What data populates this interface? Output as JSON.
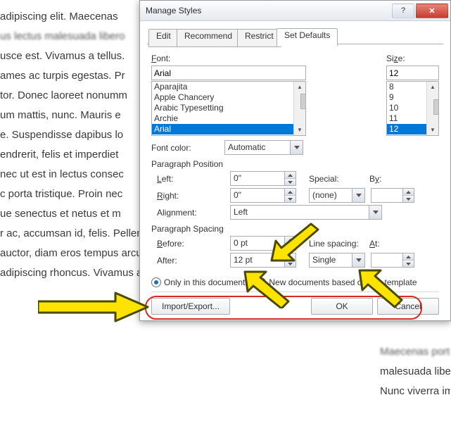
{
  "bg_lines": [
    "adipiscing elit. Maecenas",
    "us lectus malesuada libero",
    "usce est. Vivamus a tellus.",
    "ames ac turpis egestas. Pr",
    "tor. Donec laoreet nonumm",
    "um mattis, nunc. Mauris e",
    "",
    "e. Suspendisse dapibus lo",
    "endrerit, felis et imperdiet",
    "nec ut est in lectus consec",
    "c porta tristique. Proin nec",
    "ue senectus et netus et m",
    "",
    "r ac, accumsan id, felis. Pellentesque cursus sagittis felis.",
    "auctor, diam eros tempus arcu, nec vulputate augue",
    "adipiscing rhoncus. Vivamus a mi. Morbi neque. Aliquam"
  ],
  "right_col_lines": [
    "",
    "",
    "",
    "",
    "",
    "",
    "",
    "",
    "",
    "",
    "",
    "",
    "",
    "Maecenas port",
    "malesuada libe",
    "Nunc viverra im"
  ],
  "dialog": {
    "title": "Manage Styles",
    "tabs": {
      "edit": "Edit",
      "recommend": "Recommend",
      "restrict": "Restrict",
      "set_defaults": "Set Defaults"
    },
    "font_label": "Font:",
    "font_value": "Arial",
    "font_list": [
      "Aparajita",
      "Apple Chancery",
      "Arabic Typesetting",
      "Archie",
      "Arial"
    ],
    "size_label": "Size:",
    "size_value": "12",
    "size_list": [
      "8",
      "9",
      "10",
      "11",
      "12"
    ],
    "font_color_label": "Font color:",
    "font_color_value": "Automatic",
    "paragraph_position_label": "Paragraph Position",
    "left_label": "Left:",
    "left_value": "0\"",
    "right_label": "Right:",
    "right_value": "0\"",
    "special_label": "Special:",
    "special_value": "(none)",
    "by_label": "By:",
    "by_value": "",
    "alignment_label": "Alignment:",
    "alignment_value": "Left",
    "paragraph_spacing_label": "Paragraph Spacing",
    "before_label": "Before:",
    "before_value": "0 pt",
    "after_label": "After:",
    "after_value": "12 pt",
    "line_spacing_label": "Line spacing:",
    "line_spacing_value": "Single",
    "at_label": "At:",
    "at_value": "",
    "only_doc": "Only in this document",
    "new_docs": "New documents based on this template",
    "import_export": "Import/Export...",
    "ok": "OK",
    "cancel": "Cancel"
  }
}
